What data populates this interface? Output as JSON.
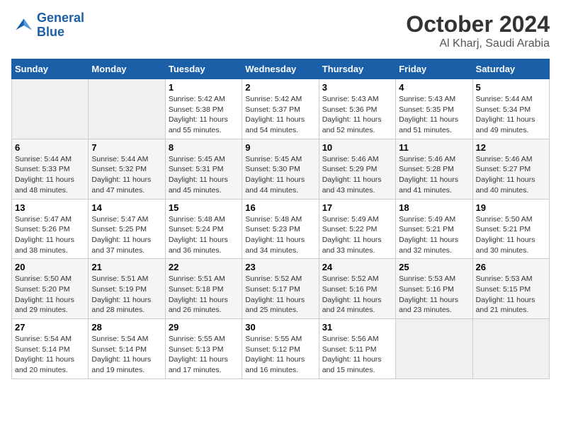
{
  "header": {
    "logo_line1": "General",
    "logo_line2": "Blue",
    "title": "October 2024",
    "subtitle": "Al Kharj, Saudi Arabia"
  },
  "days_of_week": [
    "Sunday",
    "Monday",
    "Tuesday",
    "Wednesday",
    "Thursday",
    "Friday",
    "Saturday"
  ],
  "weeks": [
    [
      {
        "num": "",
        "info": ""
      },
      {
        "num": "",
        "info": ""
      },
      {
        "num": "1",
        "info": "Sunrise: 5:42 AM\nSunset: 5:38 PM\nDaylight: 11 hours and 55 minutes."
      },
      {
        "num": "2",
        "info": "Sunrise: 5:42 AM\nSunset: 5:37 PM\nDaylight: 11 hours and 54 minutes."
      },
      {
        "num": "3",
        "info": "Sunrise: 5:43 AM\nSunset: 5:36 PM\nDaylight: 11 hours and 52 minutes."
      },
      {
        "num": "4",
        "info": "Sunrise: 5:43 AM\nSunset: 5:35 PM\nDaylight: 11 hours and 51 minutes."
      },
      {
        "num": "5",
        "info": "Sunrise: 5:44 AM\nSunset: 5:34 PM\nDaylight: 11 hours and 49 minutes."
      }
    ],
    [
      {
        "num": "6",
        "info": "Sunrise: 5:44 AM\nSunset: 5:33 PM\nDaylight: 11 hours and 48 minutes."
      },
      {
        "num": "7",
        "info": "Sunrise: 5:44 AM\nSunset: 5:32 PM\nDaylight: 11 hours and 47 minutes."
      },
      {
        "num": "8",
        "info": "Sunrise: 5:45 AM\nSunset: 5:31 PM\nDaylight: 11 hours and 45 minutes."
      },
      {
        "num": "9",
        "info": "Sunrise: 5:45 AM\nSunset: 5:30 PM\nDaylight: 11 hours and 44 minutes."
      },
      {
        "num": "10",
        "info": "Sunrise: 5:46 AM\nSunset: 5:29 PM\nDaylight: 11 hours and 43 minutes."
      },
      {
        "num": "11",
        "info": "Sunrise: 5:46 AM\nSunset: 5:28 PM\nDaylight: 11 hours and 41 minutes."
      },
      {
        "num": "12",
        "info": "Sunrise: 5:46 AM\nSunset: 5:27 PM\nDaylight: 11 hours and 40 minutes."
      }
    ],
    [
      {
        "num": "13",
        "info": "Sunrise: 5:47 AM\nSunset: 5:26 PM\nDaylight: 11 hours and 38 minutes."
      },
      {
        "num": "14",
        "info": "Sunrise: 5:47 AM\nSunset: 5:25 PM\nDaylight: 11 hours and 37 minutes."
      },
      {
        "num": "15",
        "info": "Sunrise: 5:48 AM\nSunset: 5:24 PM\nDaylight: 11 hours and 36 minutes."
      },
      {
        "num": "16",
        "info": "Sunrise: 5:48 AM\nSunset: 5:23 PM\nDaylight: 11 hours and 34 minutes."
      },
      {
        "num": "17",
        "info": "Sunrise: 5:49 AM\nSunset: 5:22 PM\nDaylight: 11 hours and 33 minutes."
      },
      {
        "num": "18",
        "info": "Sunrise: 5:49 AM\nSunset: 5:21 PM\nDaylight: 11 hours and 32 minutes."
      },
      {
        "num": "19",
        "info": "Sunrise: 5:50 AM\nSunset: 5:21 PM\nDaylight: 11 hours and 30 minutes."
      }
    ],
    [
      {
        "num": "20",
        "info": "Sunrise: 5:50 AM\nSunset: 5:20 PM\nDaylight: 11 hours and 29 minutes."
      },
      {
        "num": "21",
        "info": "Sunrise: 5:51 AM\nSunset: 5:19 PM\nDaylight: 11 hours and 28 minutes."
      },
      {
        "num": "22",
        "info": "Sunrise: 5:51 AM\nSunset: 5:18 PM\nDaylight: 11 hours and 26 minutes."
      },
      {
        "num": "23",
        "info": "Sunrise: 5:52 AM\nSunset: 5:17 PM\nDaylight: 11 hours and 25 minutes."
      },
      {
        "num": "24",
        "info": "Sunrise: 5:52 AM\nSunset: 5:16 PM\nDaylight: 11 hours and 24 minutes."
      },
      {
        "num": "25",
        "info": "Sunrise: 5:53 AM\nSunset: 5:16 PM\nDaylight: 11 hours and 23 minutes."
      },
      {
        "num": "26",
        "info": "Sunrise: 5:53 AM\nSunset: 5:15 PM\nDaylight: 11 hours and 21 minutes."
      }
    ],
    [
      {
        "num": "27",
        "info": "Sunrise: 5:54 AM\nSunset: 5:14 PM\nDaylight: 11 hours and 20 minutes."
      },
      {
        "num": "28",
        "info": "Sunrise: 5:54 AM\nSunset: 5:14 PM\nDaylight: 11 hours and 19 minutes."
      },
      {
        "num": "29",
        "info": "Sunrise: 5:55 AM\nSunset: 5:13 PM\nDaylight: 11 hours and 17 minutes."
      },
      {
        "num": "30",
        "info": "Sunrise: 5:55 AM\nSunset: 5:12 PM\nDaylight: 11 hours and 16 minutes."
      },
      {
        "num": "31",
        "info": "Sunrise: 5:56 AM\nSunset: 5:11 PM\nDaylight: 11 hours and 15 minutes."
      },
      {
        "num": "",
        "info": ""
      },
      {
        "num": "",
        "info": ""
      }
    ]
  ]
}
